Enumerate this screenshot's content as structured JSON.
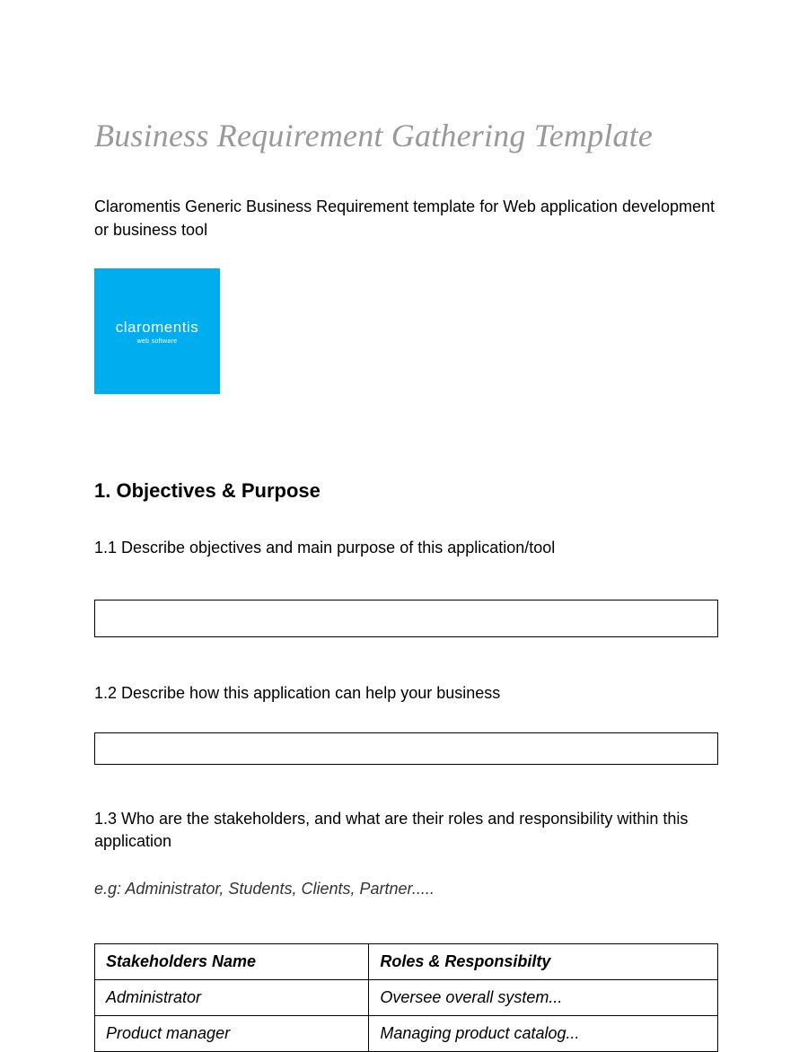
{
  "title": "Business Requirement Gathering Template",
  "intro": "Claromentis Generic Business Requirement template for Web application development or business tool",
  "logo": {
    "brand": "claromentis",
    "sub": "web software"
  },
  "section1": {
    "heading": "1. Objectives & Purpose",
    "sub1": "1.1 Describe objectives and main purpose of this application/tool",
    "sub2": "1.2 Describe how this application can help your business",
    "sub3": "1.3 Who are the stakeholders, and what are their roles and responsibility within this application",
    "example": "e.g: Administrator, Students, Clients, Partner....."
  },
  "table": {
    "headers": {
      "name": "Stakeholders Name",
      "role": "Roles & Responsibilty"
    },
    "rows": [
      {
        "name": "Administrator",
        "role": "Oversee overall system..."
      },
      {
        "name": "Product manager",
        "role": "Managing product catalog..."
      }
    ]
  }
}
